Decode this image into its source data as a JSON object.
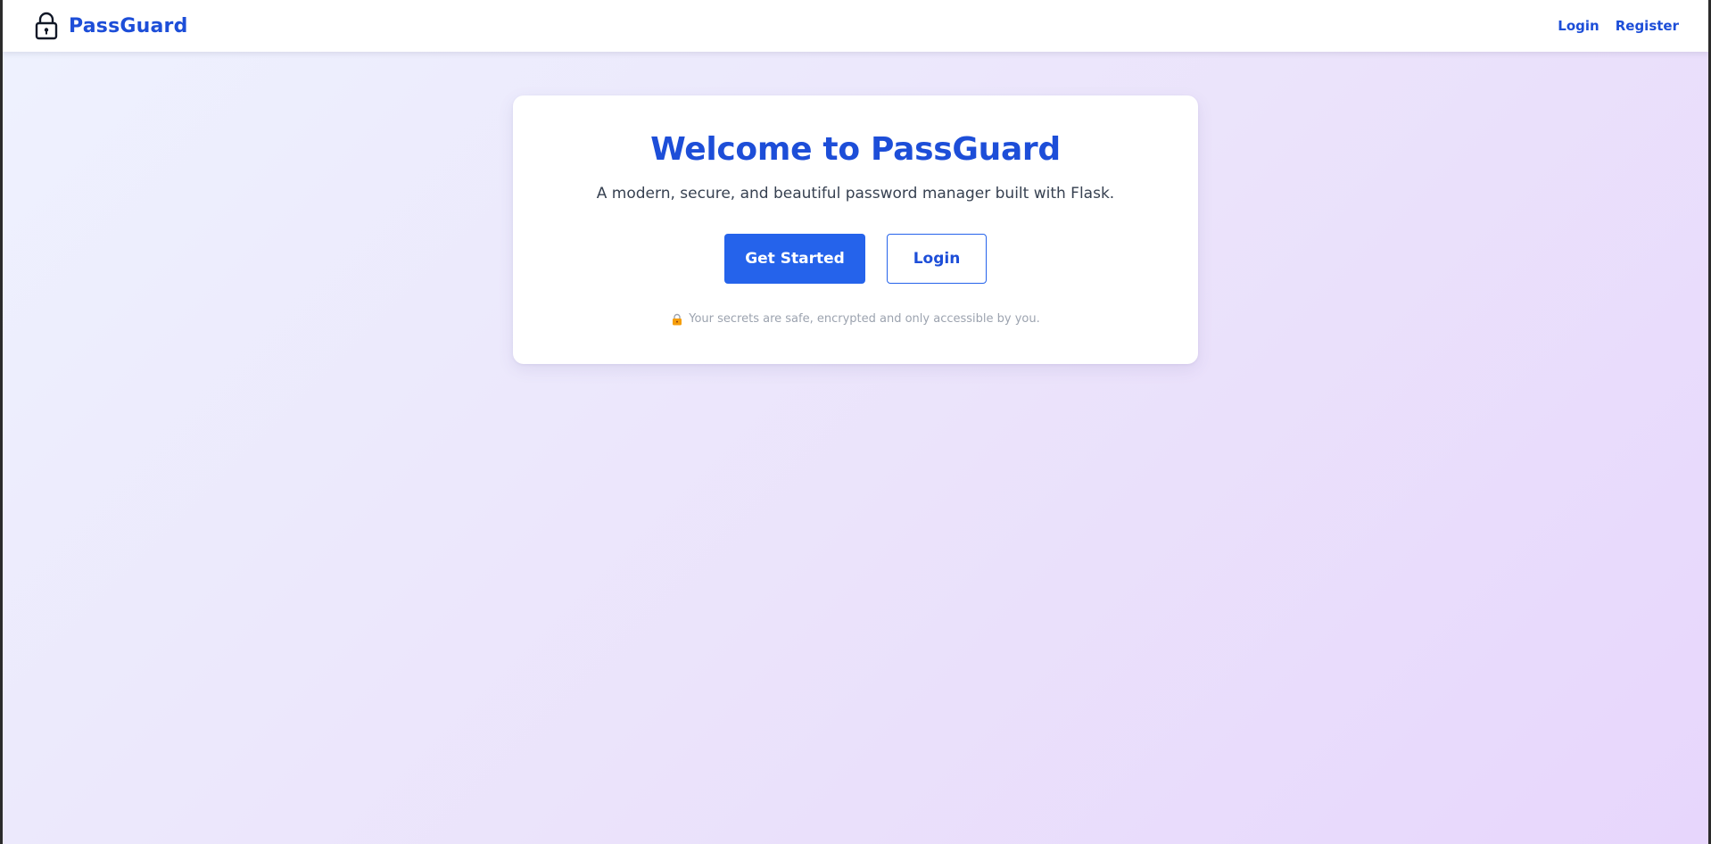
{
  "navbar": {
    "brand_name": "PassGuard",
    "brand_icon": "padlock-icon",
    "links": [
      {
        "label": "Login"
      },
      {
        "label": "Register"
      }
    ]
  },
  "hero": {
    "title": "Welcome to PassGuard",
    "subtitle": "A modern, secure, and beautiful password manager built with Flask.",
    "primary_button": "Get Started",
    "secondary_button": "Login",
    "note_icon": "lock-emoji-icon",
    "note": "Your secrets are safe, encrypted and only accessible by you."
  },
  "colors": {
    "accent": "#2563eb",
    "brand_text": "#1d4ed8",
    "background_start": "#eef2fe",
    "background_end": "#e7d6fc"
  }
}
